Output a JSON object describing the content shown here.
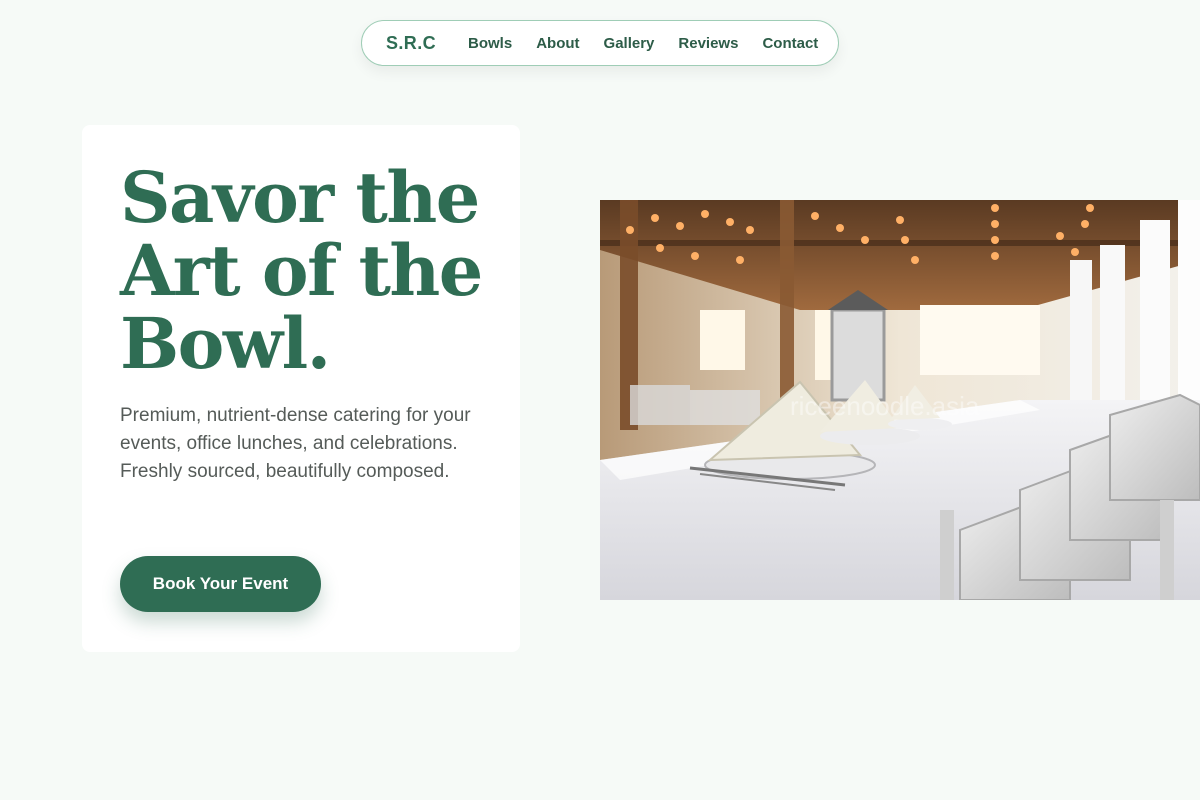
{
  "nav": {
    "brand": "S.R.C",
    "links": [
      "Bowls",
      "About",
      "Gallery",
      "Reviews",
      "Contact"
    ]
  },
  "hero": {
    "title_lines": [
      "Savor the",
      "Art of the",
      "Bowl."
    ],
    "description": "Premium, nutrient-dense catering for your events, office lunches, and celebrations. Freshly sourced, beautifully composed.",
    "cta_label": "Book Your Event",
    "image": {
      "watermark": "riceenoodle.asia"
    }
  },
  "colors": {
    "background": "#f6faf7",
    "accent": "#2f6d54",
    "nav_border": "#9fcdb6",
    "text_muted": "#555b58"
  }
}
